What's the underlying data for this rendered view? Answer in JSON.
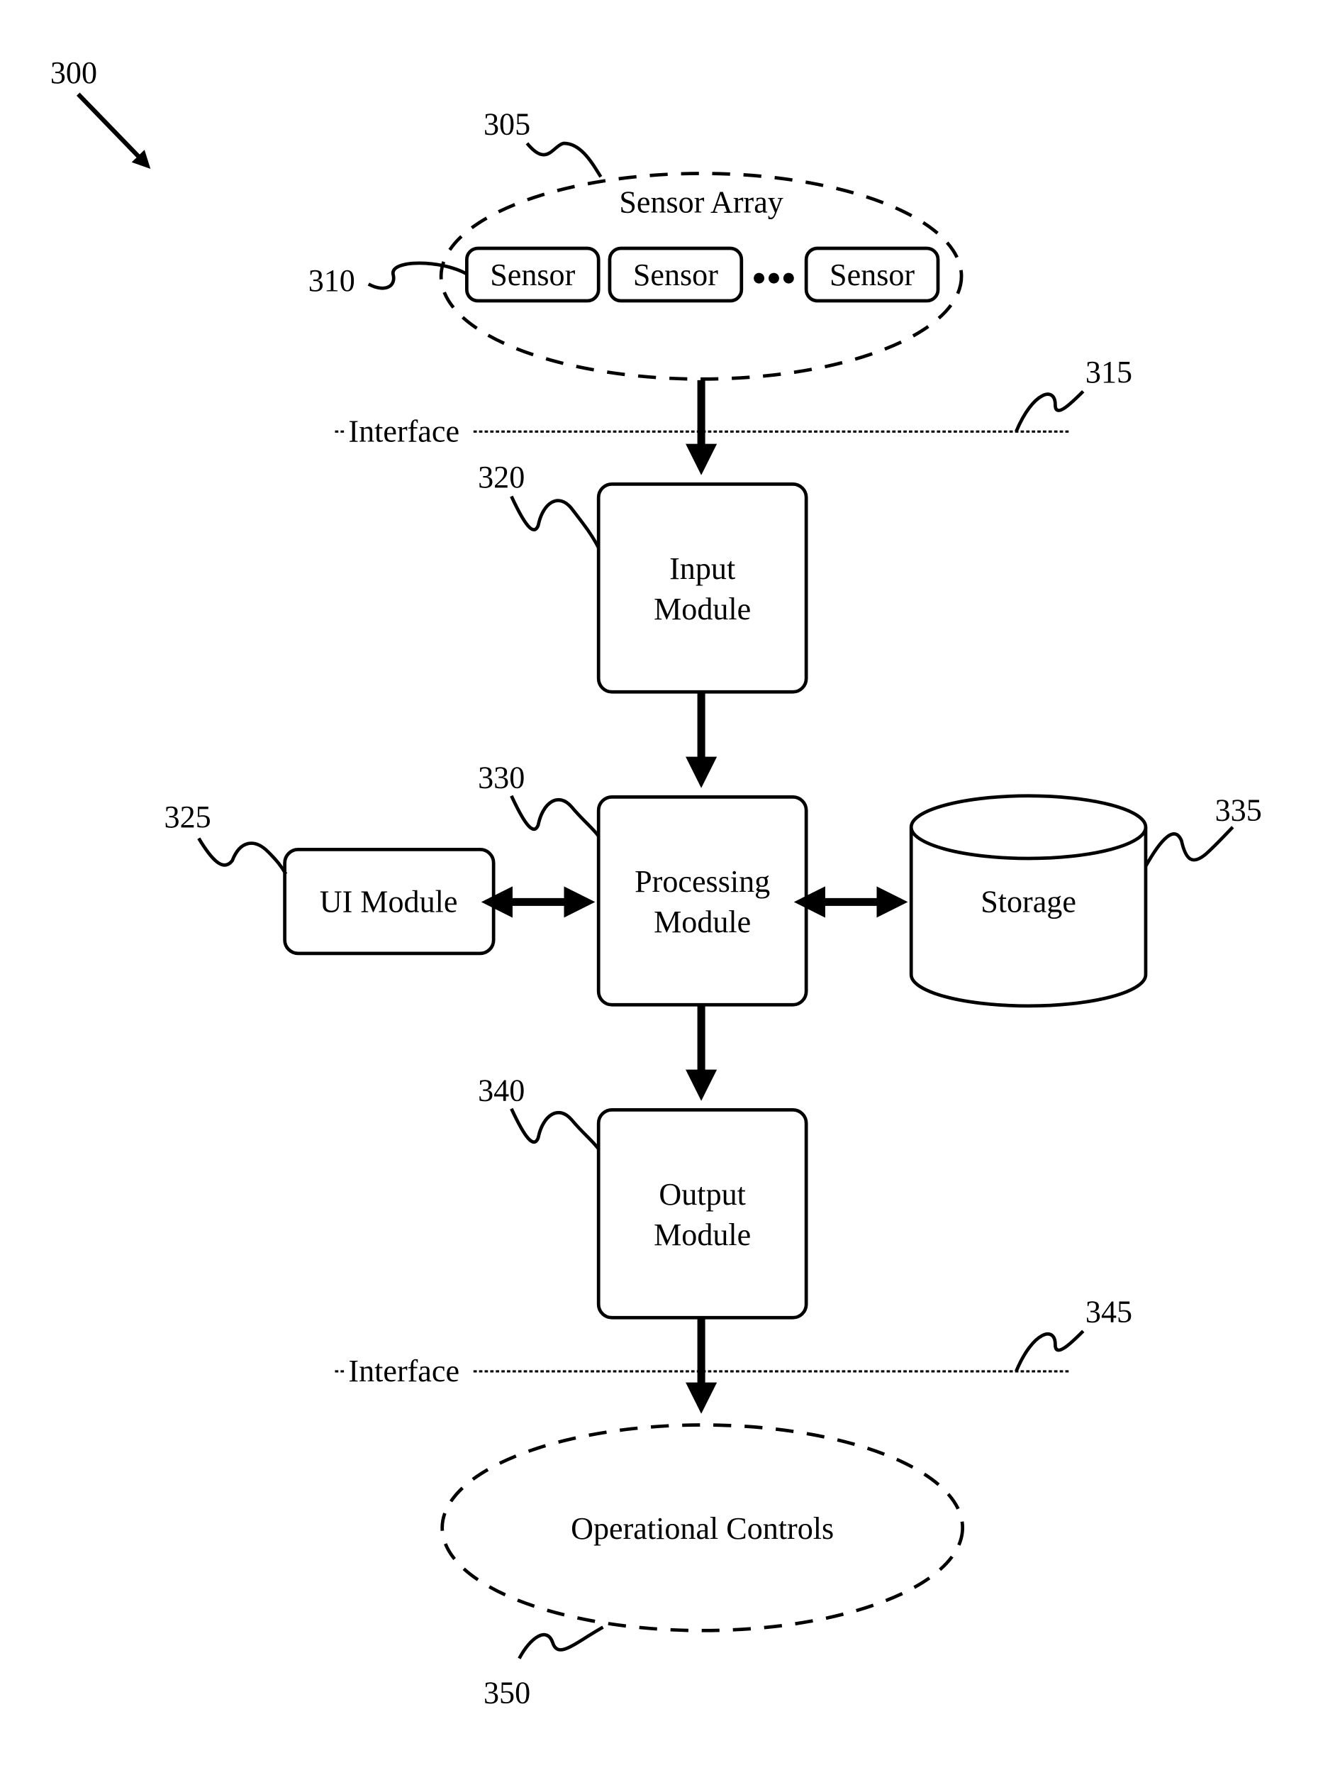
{
  "figure": {
    "ref": "300",
    "sensor_array": {
      "ref": "305",
      "label": "Sensor Array",
      "sensor_ref": "310",
      "sensors": [
        "Sensor",
        "Sensor",
        "Sensor"
      ],
      "ellipsis": "●●●"
    },
    "interface_top": {
      "ref": "315",
      "label": "Interface"
    },
    "input_module": {
      "ref": "320",
      "line1": "Input",
      "line2": "Module"
    },
    "ui_module": {
      "ref": "325",
      "label": "UI Module"
    },
    "processing_module": {
      "ref": "330",
      "line1": "Processing",
      "line2": "Module"
    },
    "storage": {
      "ref": "335",
      "label": "Storage"
    },
    "output_module": {
      "ref": "340",
      "line1": "Output",
      "line2": "Module"
    },
    "interface_bottom": {
      "ref": "345",
      "label": "Interface"
    },
    "operational_controls": {
      "ref": "350",
      "label": "Operational Controls"
    }
  }
}
